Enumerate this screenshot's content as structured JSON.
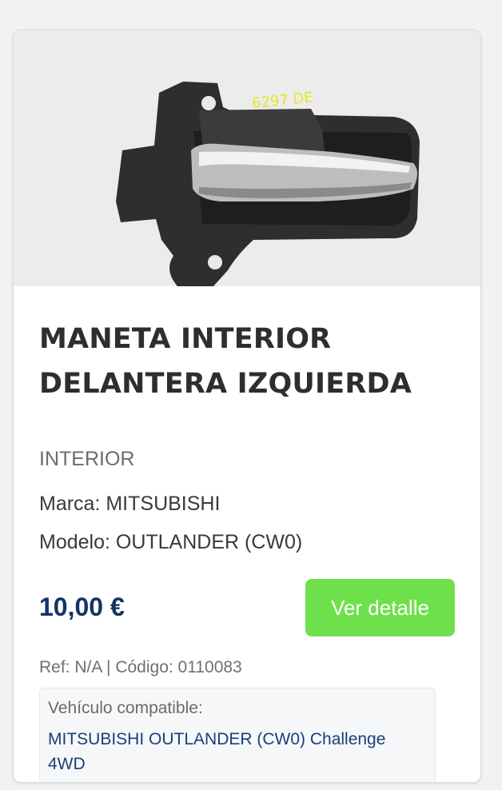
{
  "product": {
    "image_alt": "handle-photo",
    "image_marking": "6297 DE",
    "title": "MANETA INTERIOR DELANTERA IZQUIERDA",
    "category": "INTERIOR",
    "brand_label": "Marca: MITSUBISHI",
    "model_label": "Modelo: OUTLANDER (CW0)",
    "price": "10,00 €",
    "detail_button": "Ver detalle",
    "meta": "Ref: N/A | Código: 0110083",
    "compatible": {
      "label": "Vehículo compatible:",
      "vehicle": "MITSUBISHI OUTLANDER (CW0) Challenge 4WD"
    }
  },
  "colors": {
    "accent_button": "#6ee04b",
    "price_color": "#123463",
    "link_color": "#17407a"
  }
}
